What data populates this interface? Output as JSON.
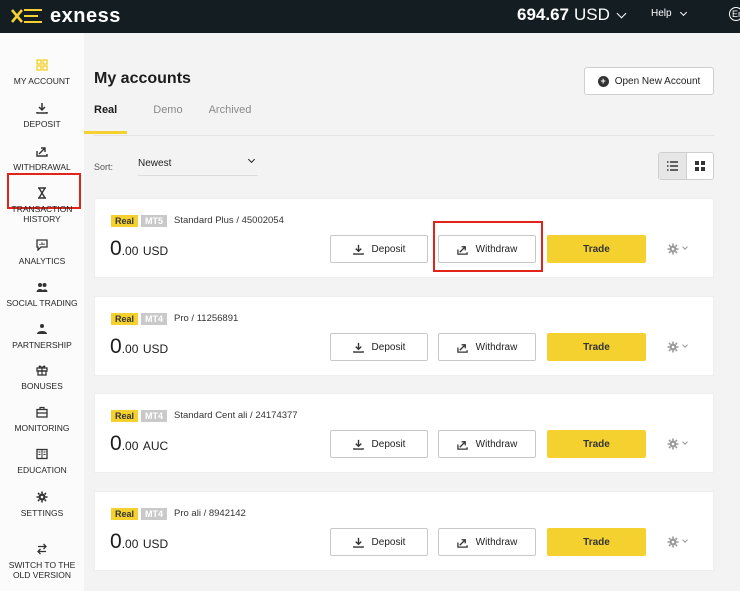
{
  "header": {
    "brand": "exness",
    "balance_amount": "694.67",
    "balance_currency": "USD",
    "help_label": "Help",
    "lang_label": "En"
  },
  "sidebar": {
    "items": [
      {
        "label": "MY ACCOUNT",
        "icon": "grid-icon"
      },
      {
        "label": "DEPOSIT",
        "icon": "download-icon"
      },
      {
        "label": "WITHDRAWAL",
        "icon": "upload-arrow-icon"
      },
      {
        "label": "TRANSACTION HISTORY",
        "icon": "hourglass-icon"
      },
      {
        "label": "ANALYTICS",
        "icon": "chat-chart-icon"
      },
      {
        "label": "SOCIAL TRADING",
        "icon": "people-icon"
      },
      {
        "label": "PARTNERSHIP",
        "icon": "handshake-icon"
      },
      {
        "label": "BONUSES",
        "icon": "gift-icon"
      },
      {
        "label": "MONITORING",
        "icon": "briefcase-icon"
      },
      {
        "label": "EDUCATION",
        "icon": "book-icon"
      },
      {
        "label": "SETTINGS",
        "icon": "gear-icon"
      },
      {
        "label": "SWITCH TO THE OLD VERSION",
        "icon": "swap-icon"
      }
    ],
    "highlighted_item": "WITHDRAWAL"
  },
  "main": {
    "title": "My accounts",
    "open_account_label": "Open New Account",
    "tabs": [
      {
        "label": "Real",
        "active": true
      },
      {
        "label": "Demo",
        "active": false
      },
      {
        "label": "Archived",
        "active": false
      }
    ],
    "sort_label": "Sort:",
    "sort_value": "Newest",
    "view_modes": [
      "list-icon",
      "grid-icon"
    ],
    "accounts": [
      {
        "type": "Real",
        "platform": "MT5",
        "name": "Standard Plus / 45002054",
        "balance_int": "0",
        "balance_dec": ".00",
        "currency": "USD",
        "deposit_label": "Deposit",
        "withdraw_label": "Withdraw",
        "trade_label": "Trade"
      },
      {
        "type": "Real",
        "platform": "MT4",
        "name": "Pro / 11256891",
        "balance_int": "0",
        "balance_dec": ".00",
        "currency": "USD",
        "deposit_label": "Deposit",
        "withdraw_label": "Withdraw",
        "trade_label": "Trade"
      },
      {
        "type": "Real",
        "platform": "MT4",
        "name": "Standard Cent ali / 24174377",
        "balance_int": "0",
        "balance_dec": ".00",
        "currency": "AUC",
        "deposit_label": "Deposit",
        "withdraw_label": "Withdraw",
        "trade_label": "Trade"
      },
      {
        "type": "Real",
        "platform": "MT4",
        "name": "Pro ali / 8942142",
        "balance_int": "0",
        "balance_dec": ".00",
        "currency": "USD",
        "deposit_label": "Deposit",
        "withdraw_label": "Withdraw",
        "trade_label": "Trade"
      }
    ]
  },
  "colors": {
    "topbar": "#141d22",
    "accent_yellow": "#f5d12f",
    "highlight_red": "#e2231a"
  }
}
